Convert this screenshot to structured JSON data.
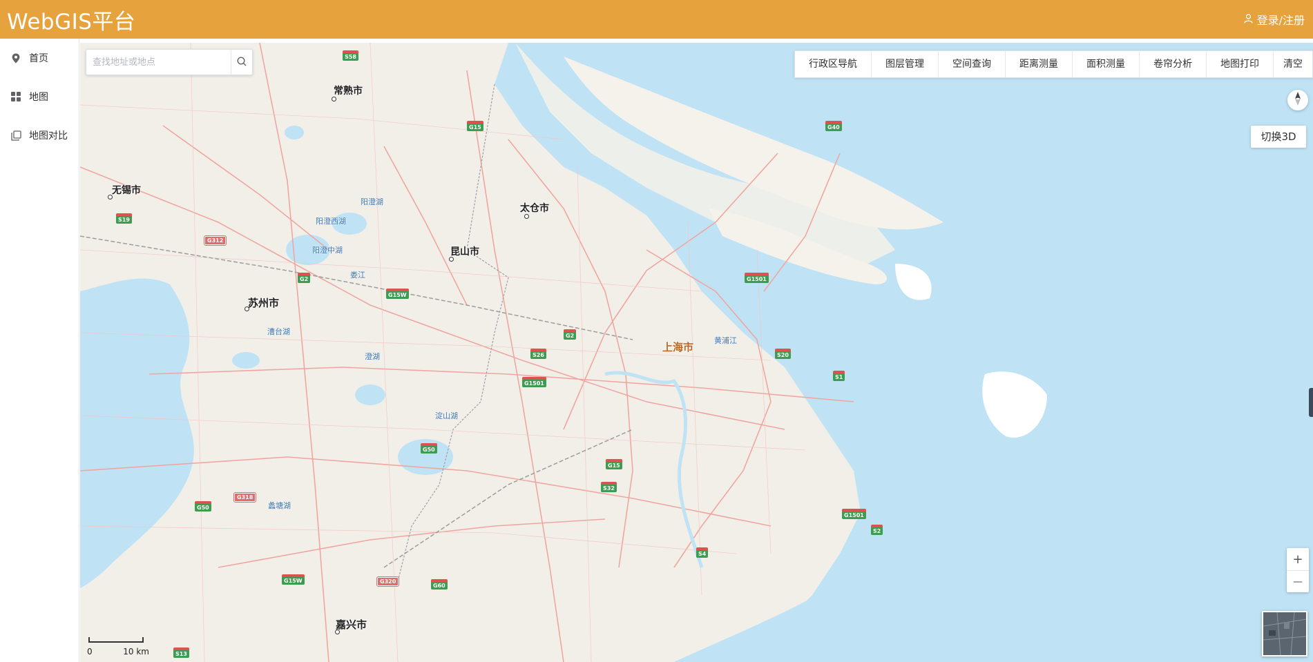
{
  "header": {
    "app_title": "WebGIS平台",
    "login_label": "登录/注册",
    "background_color": "#e6a23c"
  },
  "sidebar": {
    "items": [
      {
        "label": "首页",
        "icon": "location-pin-icon"
      },
      {
        "label": "地图",
        "icon": "grid-icon"
      },
      {
        "label": "地图对比",
        "icon": "copy-layers-icon"
      }
    ]
  },
  "search": {
    "placeholder": "查找地址或地点",
    "value": ""
  },
  "toolbar": {
    "items": [
      "行政区导航",
      "图层管理",
      "空间查询",
      "距离测量",
      "面积测量",
      "卷帘分析",
      "地图打印",
      "清空"
    ]
  },
  "map_controls": {
    "switch_3d_label": "切换3D",
    "zoom_in": "+",
    "zoom_out": "—",
    "scale_start": "0",
    "scale_end": "10 km"
  },
  "map_labels": {
    "cities": [
      "常熟市",
      "无锡市",
      "太仓市",
      "昆山市",
      "苏州市",
      "上海市",
      "嘉兴市"
    ],
    "places": [
      "阳澄湖",
      "阳澄西湖",
      "阳澄中湖",
      "娄江",
      "漕台湖",
      "澄湖",
      "淀山湖",
      "黄浦江",
      "蠡塘湖"
    ],
    "highways": [
      "S58",
      "G15",
      "G40",
      "S19",
      "G312",
      "G2",
      "G15W",
      "G1501",
      "G2",
      "S26",
      "S20",
      "S1",
      "G1501",
      "G50",
      "G15",
      "S32",
      "G1501",
      "S2",
      "G50",
      "G318",
      "S4",
      "G320",
      "G15W",
      "G60",
      "S13"
    ]
  }
}
